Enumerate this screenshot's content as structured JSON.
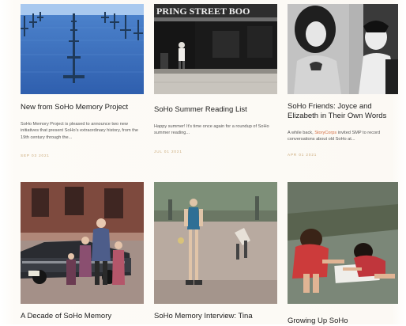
{
  "articles": [
    {
      "title": "New from SoHo Memory Project",
      "excerpt": "SoHo Memory Project is pleased to announce two new initiatives that present SoHo's extraordinary history, from the 19th century through the...",
      "date": "SEP 03 2021"
    },
    {
      "title": "SoHo Summer Reading List",
      "excerpt": "Happy summer! It's time once again for a roundup of SoHo summer reading...",
      "date": "JUL 01 2021",
      "sign_text": "PRING STREET BOO"
    },
    {
      "title": "SoHo Friends: Joyce and Elizabeth in Their Own Words",
      "excerpt_pre": "A while back, ",
      "excerpt_link": "StoryCorps",
      "excerpt_post": " invited SMP to record conversations about old SoHo at...",
      "date": "APR 01 2021"
    },
    {
      "title": "A Decade of SoHo Memory"
    },
    {
      "title": "SoHo Memory Interview: Tina"
    },
    {
      "title": "Growing Up SoHo"
    }
  ],
  "colors": {
    "accent_link": "#d36a3c",
    "date": "#c9a877",
    "title": "#1e1e1e"
  }
}
